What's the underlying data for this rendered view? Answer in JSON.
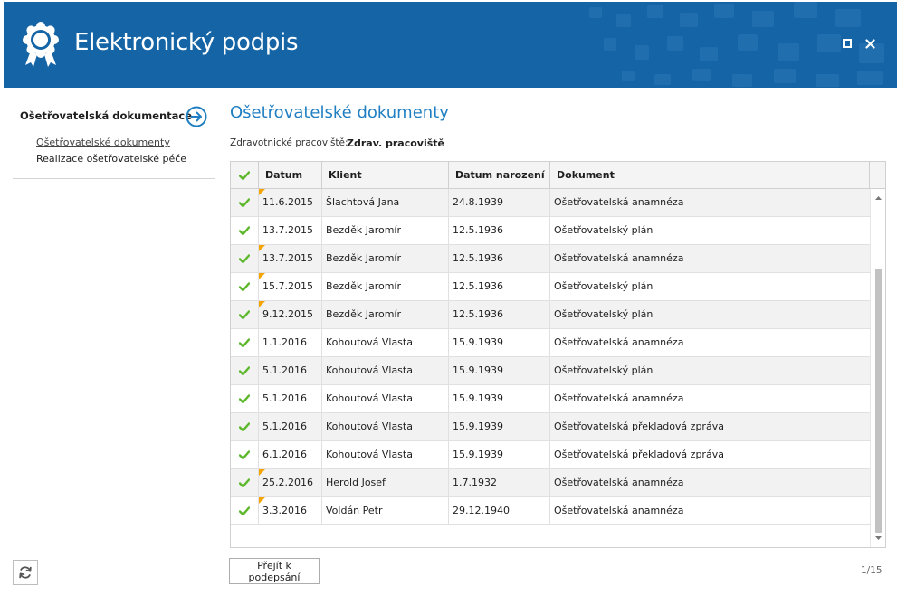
{
  "app": {
    "title": "Elektronický podpis",
    "icons": {
      "logo": "award-seal-icon",
      "maximize": "maximize-icon",
      "close": "close-icon"
    },
    "colors": {
      "header_bg": "#1565a6",
      "accent": "#1f7fc2",
      "check": "#5cb82a",
      "flag": "#f5a400"
    }
  },
  "sidebar": {
    "heading": "Ošetřovatelská dokumentace",
    "heading_icon": "arrow-right-circle-icon",
    "items": [
      {
        "label": "Ošetřovatelské dokumenty",
        "active": true
      },
      {
        "label": "Realizace ošetřovatelské péče",
        "active": false
      }
    ],
    "refresh_icon": "refresh-icon"
  },
  "main": {
    "title": "Ošetřovatelské dokumenty",
    "workstation_label": "Zdravotnické pracoviště:",
    "workstation_value": "Zdrav. pracoviště",
    "columns": [
      "Datum",
      "Klient",
      "Datum narození",
      "Dokument"
    ],
    "check_header_icon": "checkmark-icon",
    "rows": [
      {
        "checked": true,
        "flag": true,
        "date": "11.6.2015",
        "client": "Šlachtová Jana",
        "birth": "24.8.1939",
        "doc": "Ošetřovatelská anamnéza"
      },
      {
        "checked": true,
        "flag": false,
        "date": "13.7.2015",
        "client": "Bezděk Jaromír",
        "birth": "12.5.1936",
        "doc": "Ošetřovatelský plán"
      },
      {
        "checked": true,
        "flag": true,
        "date": "13.7.2015",
        "client": "Bezděk Jaromír",
        "birth": "12.5.1936",
        "doc": "Ošetřovatelská anamnéza"
      },
      {
        "checked": true,
        "flag": true,
        "date": "15.7.2015",
        "client": "Bezděk Jaromír",
        "birth": "12.5.1936",
        "doc": "Ošetřovatelský plán"
      },
      {
        "checked": true,
        "flag": true,
        "date": "9.12.2015",
        "client": "Bezděk Jaromír",
        "birth": "12.5.1936",
        "doc": "Ošetřovatelský plán"
      },
      {
        "checked": true,
        "flag": false,
        "date": "1.1.2016",
        "client": "Kohoutová Vlasta",
        "birth": "15.9.1939",
        "doc": "Ošetřovatelská anamnéza"
      },
      {
        "checked": true,
        "flag": false,
        "date": "5.1.2016",
        "client": "Kohoutová Vlasta",
        "birth": "15.9.1939",
        "doc": "Ošetřovatelský plán"
      },
      {
        "checked": true,
        "flag": false,
        "date": "5.1.2016",
        "client": "Kohoutová Vlasta",
        "birth": "15.9.1939",
        "doc": "Ošetřovatelská anamnéza"
      },
      {
        "checked": true,
        "flag": false,
        "date": "5.1.2016",
        "client": "Kohoutová Vlasta",
        "birth": "15.9.1939",
        "doc": "Ošetřovatelská překladová zpráva"
      },
      {
        "checked": true,
        "flag": false,
        "date": "6.1.2016",
        "client": "Kohoutová Vlasta",
        "birth": "15.9.1939",
        "doc": "Ošetřovatelská překladová zpráva"
      },
      {
        "checked": true,
        "flag": true,
        "date": "25.2.2016",
        "client": "Herold Josef",
        "birth": "1.7.1932",
        "doc": "Ošetřovatelská anamnéza"
      },
      {
        "checked": true,
        "flag": true,
        "date": "3.3.2016",
        "client": "Voldán Petr",
        "birth": "29.12.1940",
        "doc": "Ošetřovatelská anamnéza"
      }
    ]
  },
  "footer": {
    "sign_button": "Přejít k podepsání",
    "pager": "1/15"
  }
}
